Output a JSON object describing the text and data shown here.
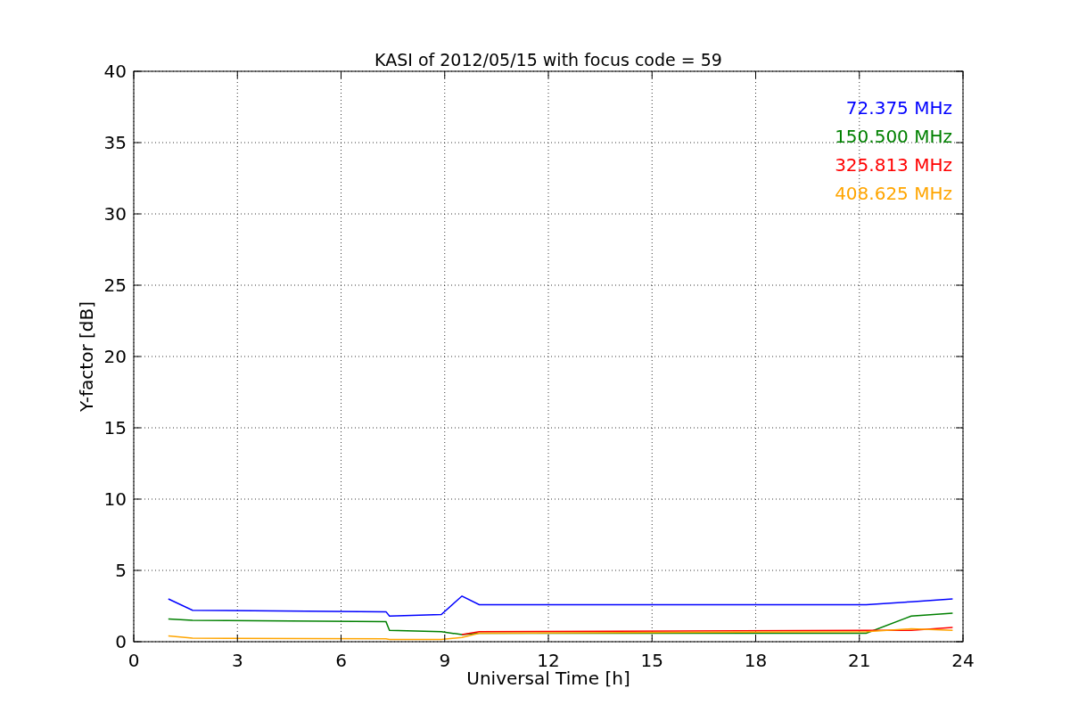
{
  "chart_data": {
    "type": "line",
    "title": "KASI of 2012/05/15 with focus code = 59",
    "xlabel": "Universal Time [h]",
    "ylabel": "Y-factor [dB]",
    "x": [
      1,
      1.7,
      7.3,
      7.4,
      8.9,
      9.5,
      10,
      21.2,
      22.5,
      23.7
    ],
    "series": [
      {
        "name": "72.375 MHz",
        "color": "#0000ff",
        "values": [
          3,
          2.2,
          2.1,
          1.8,
          1.9,
          3.2,
          2.6,
          2.6,
          2.8,
          3
        ]
      },
      {
        "name": "150.500 MHz",
        "color": "#008000",
        "values": [
          1.6,
          1.5,
          1.4,
          0.8,
          0.7,
          0.5,
          0.6,
          0.6,
          1.8,
          2
        ]
      },
      {
        "name": "325.813 MHz",
        "color": "#ff0000",
        "values": [
          null,
          null,
          null,
          null,
          null,
          0.5,
          0.7,
          0.8,
          0.8,
          1.0
        ]
      },
      {
        "name": "408.625 MHz",
        "color": "#ffa500",
        "values": [
          0.4,
          0.25,
          0.2,
          0.15,
          0.15,
          0.3,
          0.6,
          0.7,
          0.9,
          0.8
        ]
      }
    ],
    "grid": true,
    "xlim": [
      0,
      24
    ],
    "ylim": [
      0,
      40
    ],
    "xticks": [
      0,
      3,
      6,
      9,
      12,
      15,
      18,
      21,
      24
    ],
    "yticks": [
      0,
      5,
      10,
      15,
      20,
      25,
      30,
      35,
      40
    ]
  }
}
